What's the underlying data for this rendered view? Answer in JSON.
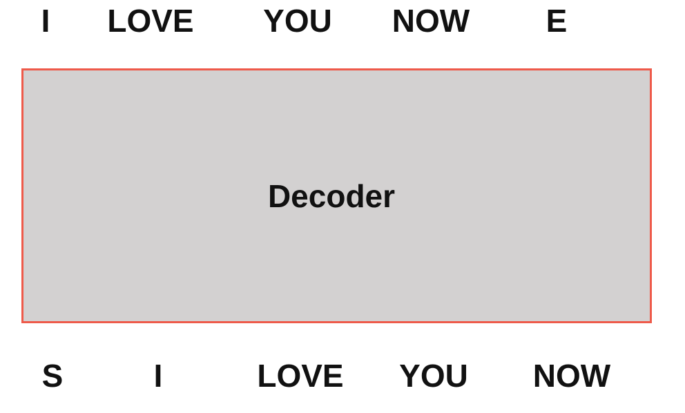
{
  "diagram": {
    "output_tokens": [
      "I",
      "LOVE",
      "YOU",
      "NOW",
      "E"
    ],
    "decoder_label": "Decoder",
    "input_tokens": [
      "S",
      "I",
      "LOVE",
      "YOU",
      "NOW"
    ],
    "colors": {
      "box_fill": "#d3d1d1",
      "box_border": "#ee5a4a",
      "text": "#111111",
      "background": "#ffffff"
    }
  }
}
